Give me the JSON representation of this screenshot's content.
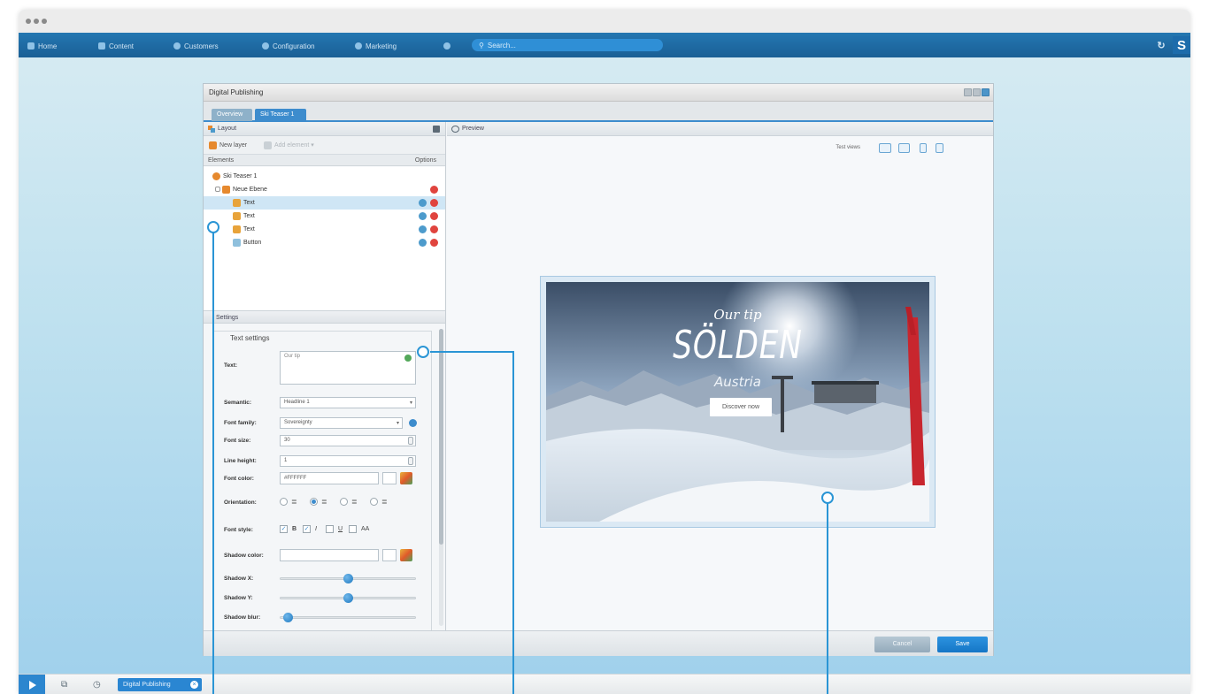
{
  "nav": {
    "home": "Home",
    "content": "Content",
    "customers": "Customers",
    "configuration": "Configuration",
    "marketing": "Marketing",
    "search_placeholder": "Search...",
    "logo": "S"
  },
  "window": {
    "title": "Digital Publishing",
    "tabs": [
      {
        "label": "Overview"
      },
      {
        "label": "Ski Teaser 1"
      }
    ]
  },
  "layout_panel": {
    "title": "Layout",
    "new_layer": "New layer",
    "add_element": "Add element",
    "col_elements": "Elements",
    "col_options": "Options",
    "tree": [
      {
        "label": "Ski Teaser 1"
      },
      {
        "label": "Neue Ebene"
      },
      {
        "label": "Text"
      },
      {
        "label": "Text"
      },
      {
        "label": "Text"
      },
      {
        "label": "Button"
      }
    ]
  },
  "settings_panel": {
    "title": "Settings",
    "legend": "Text settings",
    "fields": {
      "text_label": "Text:",
      "text_value": "Our tip",
      "semantic_label": "Semantic:",
      "semantic_value": "Headline 1",
      "font_family_label": "Font family:",
      "font_family_value": "Sovereignty",
      "font_size_label": "Font size:",
      "font_size_value": "30",
      "line_height_label": "Line height:",
      "line_height_value": "1",
      "font_color_label": "Font color:",
      "font_color_value": "#FFFFFF",
      "orientation_label": "Orientation:",
      "font_style_label": "Font style:",
      "style_bold": "B",
      "style_italic": "I",
      "style_underline": "U",
      "style_caps": "AA",
      "shadow_color_label": "Shadow color:",
      "shadow_x_label": "Shadow X:",
      "shadow_y_label": "Shadow Y:",
      "shadow_blur_label": "Shadow blur:"
    },
    "orientation_selected": 1,
    "style_checked": {
      "bold": true,
      "italic": true,
      "underline": false,
      "caps": false
    },
    "shadow_x_fraction": 0.5,
    "shadow_y_fraction": 0.5,
    "shadow_blur_fraction": 0.05
  },
  "preview_panel": {
    "title": "Preview",
    "test_label": "Test views",
    "teaser": {
      "tagline": "Our tip",
      "headline": "SÖLDEN",
      "subline": "Austria",
      "button": "Discover now"
    }
  },
  "footer": {
    "cancel": "Cancel",
    "save": "Save"
  },
  "taskbar": {
    "task": "Digital Publishing"
  },
  "colors": {
    "accent": "#2a95d5",
    "nav_bg": "#1f6aa5",
    "delete": "#e0443e"
  }
}
